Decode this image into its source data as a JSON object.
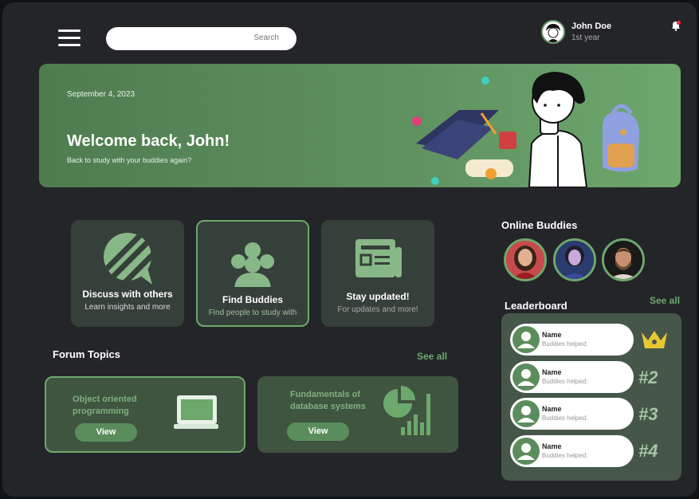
{
  "header": {
    "search_placeholder": "Search",
    "user_name": "John Doe",
    "user_year": "1st year"
  },
  "banner": {
    "date": "September 4,  2023",
    "title": "Welcome back, John!",
    "subtitle": "Back to study with your buddies again?"
  },
  "features": [
    {
      "title": "Discuss with others",
      "subtitle": "Learn insights and more",
      "icon": "chat-icon"
    },
    {
      "title": "Find Buddies",
      "subtitle": "Find people to study with",
      "icon": "group-icon"
    },
    {
      "title": "Stay updated!",
      "subtitle": "For updates and more!",
      "icon": "news-icon"
    }
  ],
  "forum": {
    "title": "Forum Topics",
    "see_all": "See all",
    "topics": [
      {
        "title_line1": "Object oriented",
        "title_line2": "programming",
        "button": "View",
        "icon": "laptop-icon"
      },
      {
        "title_line1": "Fundamentals of",
        "title_line2": "database systems",
        "button": "View",
        "icon": "chart-icon"
      }
    ]
  },
  "online": {
    "title": "Online Buddies"
  },
  "leaderboard": {
    "title": "Leaderboard",
    "see_all": "See all",
    "rows": [
      {
        "name": "Name",
        "sub": "Buddies helped:",
        "rank": "crown"
      },
      {
        "name": "Name",
        "sub": "Buddies helped:",
        "rank": "#2"
      },
      {
        "name": "Name",
        "sub": "Buddies helped:",
        "rank": "#3"
      },
      {
        "name": "Name",
        "sub": "Buddies helped:",
        "rank": "#4"
      }
    ]
  },
  "colors": {
    "accent": "#6da86d",
    "background": "#242528",
    "card": "#36403a"
  }
}
